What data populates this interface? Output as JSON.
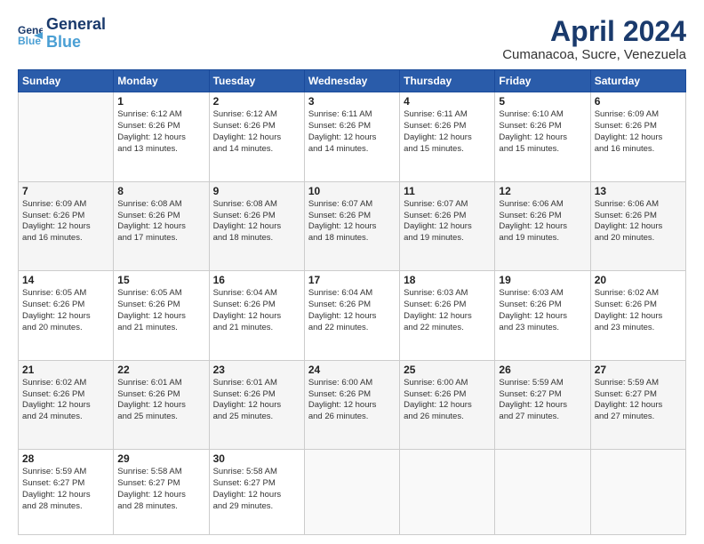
{
  "header": {
    "logo_line1": "General",
    "logo_line2": "Blue",
    "title": "April 2024",
    "location": "Cumanacoa, Sucre, Venezuela"
  },
  "days_of_week": [
    "Sunday",
    "Monday",
    "Tuesday",
    "Wednesday",
    "Thursday",
    "Friday",
    "Saturday"
  ],
  "weeks": [
    [
      {
        "day": "",
        "info": ""
      },
      {
        "day": "1",
        "info": "Sunrise: 6:12 AM\nSunset: 6:26 PM\nDaylight: 12 hours\nand 13 minutes."
      },
      {
        "day": "2",
        "info": "Sunrise: 6:12 AM\nSunset: 6:26 PM\nDaylight: 12 hours\nand 14 minutes."
      },
      {
        "day": "3",
        "info": "Sunrise: 6:11 AM\nSunset: 6:26 PM\nDaylight: 12 hours\nand 14 minutes."
      },
      {
        "day": "4",
        "info": "Sunrise: 6:11 AM\nSunset: 6:26 PM\nDaylight: 12 hours\nand 15 minutes."
      },
      {
        "day": "5",
        "info": "Sunrise: 6:10 AM\nSunset: 6:26 PM\nDaylight: 12 hours\nand 15 minutes."
      },
      {
        "day": "6",
        "info": "Sunrise: 6:09 AM\nSunset: 6:26 PM\nDaylight: 12 hours\nand 16 minutes."
      }
    ],
    [
      {
        "day": "7",
        "info": "Sunrise: 6:09 AM\nSunset: 6:26 PM\nDaylight: 12 hours\nand 16 minutes."
      },
      {
        "day": "8",
        "info": "Sunrise: 6:08 AM\nSunset: 6:26 PM\nDaylight: 12 hours\nand 17 minutes."
      },
      {
        "day": "9",
        "info": "Sunrise: 6:08 AM\nSunset: 6:26 PM\nDaylight: 12 hours\nand 18 minutes."
      },
      {
        "day": "10",
        "info": "Sunrise: 6:07 AM\nSunset: 6:26 PM\nDaylight: 12 hours\nand 18 minutes."
      },
      {
        "day": "11",
        "info": "Sunrise: 6:07 AM\nSunset: 6:26 PM\nDaylight: 12 hours\nand 19 minutes."
      },
      {
        "day": "12",
        "info": "Sunrise: 6:06 AM\nSunset: 6:26 PM\nDaylight: 12 hours\nand 19 minutes."
      },
      {
        "day": "13",
        "info": "Sunrise: 6:06 AM\nSunset: 6:26 PM\nDaylight: 12 hours\nand 20 minutes."
      }
    ],
    [
      {
        "day": "14",
        "info": "Sunrise: 6:05 AM\nSunset: 6:26 PM\nDaylight: 12 hours\nand 20 minutes."
      },
      {
        "day": "15",
        "info": "Sunrise: 6:05 AM\nSunset: 6:26 PM\nDaylight: 12 hours\nand 21 minutes."
      },
      {
        "day": "16",
        "info": "Sunrise: 6:04 AM\nSunset: 6:26 PM\nDaylight: 12 hours\nand 21 minutes."
      },
      {
        "day": "17",
        "info": "Sunrise: 6:04 AM\nSunset: 6:26 PM\nDaylight: 12 hours\nand 22 minutes."
      },
      {
        "day": "18",
        "info": "Sunrise: 6:03 AM\nSunset: 6:26 PM\nDaylight: 12 hours\nand 22 minutes."
      },
      {
        "day": "19",
        "info": "Sunrise: 6:03 AM\nSunset: 6:26 PM\nDaylight: 12 hours\nand 23 minutes."
      },
      {
        "day": "20",
        "info": "Sunrise: 6:02 AM\nSunset: 6:26 PM\nDaylight: 12 hours\nand 23 minutes."
      }
    ],
    [
      {
        "day": "21",
        "info": "Sunrise: 6:02 AM\nSunset: 6:26 PM\nDaylight: 12 hours\nand 24 minutes."
      },
      {
        "day": "22",
        "info": "Sunrise: 6:01 AM\nSunset: 6:26 PM\nDaylight: 12 hours\nand 25 minutes."
      },
      {
        "day": "23",
        "info": "Sunrise: 6:01 AM\nSunset: 6:26 PM\nDaylight: 12 hours\nand 25 minutes."
      },
      {
        "day": "24",
        "info": "Sunrise: 6:00 AM\nSunset: 6:26 PM\nDaylight: 12 hours\nand 26 minutes."
      },
      {
        "day": "25",
        "info": "Sunrise: 6:00 AM\nSunset: 6:26 PM\nDaylight: 12 hours\nand 26 minutes."
      },
      {
        "day": "26",
        "info": "Sunrise: 5:59 AM\nSunset: 6:27 PM\nDaylight: 12 hours\nand 27 minutes."
      },
      {
        "day": "27",
        "info": "Sunrise: 5:59 AM\nSunset: 6:27 PM\nDaylight: 12 hours\nand 27 minutes."
      }
    ],
    [
      {
        "day": "28",
        "info": "Sunrise: 5:59 AM\nSunset: 6:27 PM\nDaylight: 12 hours\nand 28 minutes."
      },
      {
        "day": "29",
        "info": "Sunrise: 5:58 AM\nSunset: 6:27 PM\nDaylight: 12 hours\nand 28 minutes."
      },
      {
        "day": "30",
        "info": "Sunrise: 5:58 AM\nSunset: 6:27 PM\nDaylight: 12 hours\nand 29 minutes."
      },
      {
        "day": "",
        "info": ""
      },
      {
        "day": "",
        "info": ""
      },
      {
        "day": "",
        "info": ""
      },
      {
        "day": "",
        "info": ""
      }
    ]
  ]
}
